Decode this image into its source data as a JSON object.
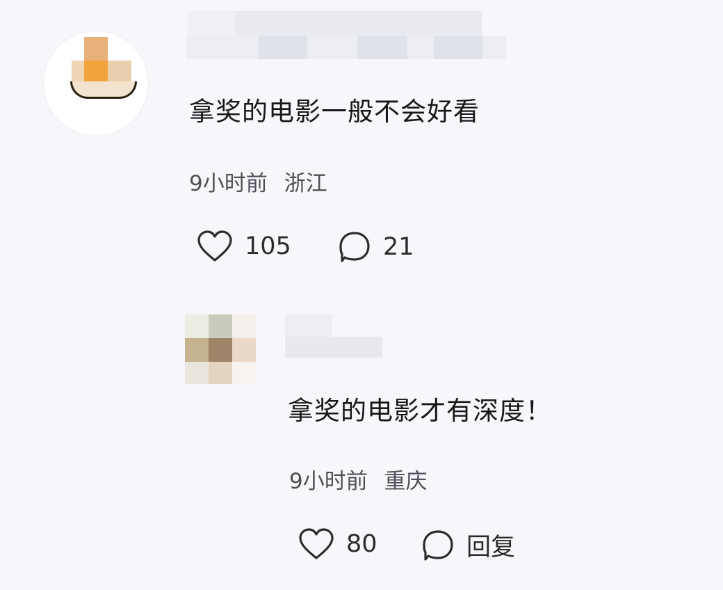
{
  "comments": [
    {
      "text": "拿奖的电影一般不会好看",
      "time": "9小时前",
      "location": "浙江",
      "likes": "105",
      "replies": "21",
      "icons": {
        "like": "heart-icon",
        "comment": "comment-bubble-icon"
      }
    },
    {
      "text": "拿奖的电影才有深度！",
      "time": "9小时前",
      "location": "重庆",
      "likes": "80",
      "reply_label": "回复",
      "icons": {
        "like": "heart-icon",
        "comment": "comment-bubble-icon"
      }
    }
  ],
  "colors": {
    "background": "#f7f7fb",
    "text": "#171717",
    "meta": "#4f4f5a"
  }
}
